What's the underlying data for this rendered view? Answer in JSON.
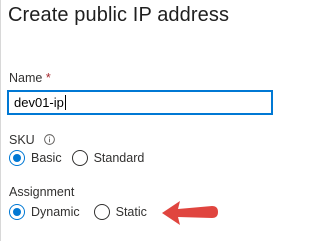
{
  "panel": {
    "title": "Create public IP address"
  },
  "name_field": {
    "label": "Name",
    "required_mark": "*",
    "value": "dev01-ip"
  },
  "sku": {
    "label": "SKU",
    "info_icon": "info-icon",
    "options": [
      {
        "label": "Basic",
        "selected": true
      },
      {
        "label": "Standard",
        "selected": false
      }
    ]
  },
  "assignment": {
    "label": "Assignment",
    "options": [
      {
        "label": "Dynamic",
        "selected": true
      },
      {
        "label": "Static",
        "selected": false
      }
    ]
  },
  "annotation": {
    "icon": "red-arrow-pointer",
    "color": "#e0453f"
  },
  "colors": {
    "accent": "#0078d4",
    "required": "#a4262c"
  }
}
